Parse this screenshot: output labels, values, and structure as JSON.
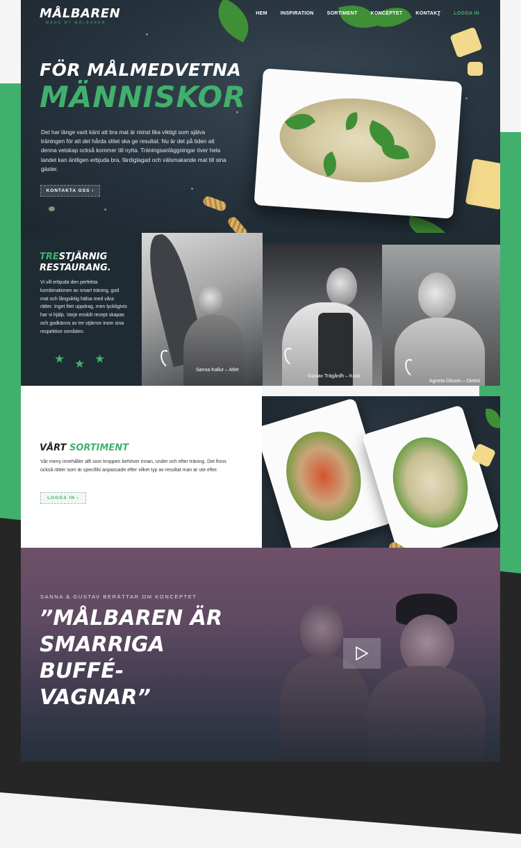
{
  "brand": {
    "name": "MÅLBAREN",
    "tagline": "MADE BY MÅLBAREN"
  },
  "nav": {
    "items": [
      "HEM",
      "INSPIRATION",
      "SORTIMENT",
      "KONCEPTET",
      "KONTAKT",
      "LOGGA IN"
    ]
  },
  "hero": {
    "title_line1": "FÖR MÅLMEDVETNA",
    "title_line2": "MÄNNISKOR",
    "body": "Det har länge varit känt att bra mat är minst lika viktigt som själva träningen för att det hårda slitet ska ge resultat. Nu är det på tiden att denna vetskap också kommer till nytta. Träningsanläggningar över hela landet kan äntligen erbjuda bra, färdiglagad och välsmakande mat till sina gäster.",
    "cta": "KONTAKTA OSS ›"
  },
  "restaurant": {
    "title_green": "TRE",
    "title_rest": "STJÄRNIG",
    "title_line2": "RESTAURANG.",
    "body": "Vi vill erbjuda den perfekta kombinationen av smart träning, god mat och långsiktig hälsa med våra rätter. Inget litet uppdrag, men lyckligtvis har vi hjälp. Varje enskilt recept skapas och godkänns av tre stjärnor inom sina respektive områden.",
    "stars": "★",
    "people": [
      {
        "caption": "Sanna Kallur – Atlet"
      },
      {
        "caption": "Gustav Trägårdh – Kock"
      },
      {
        "caption": "Agneta Olsson – Dietist"
      }
    ]
  },
  "sortiment": {
    "title_dark": "VÅRT ",
    "title_green": "SORTIMENT",
    "body": "Vår meny innehåller allt som kroppen behöver innan, under och efter träning. Det finns också rätter som är specifikt anpassade efter vilket typ av resultat man är ute efter.",
    "cta": "LOGGA IN ›"
  },
  "video": {
    "kicker": "SANNA & GUSTAV BERÄTTAR OM KONCEPTET",
    "quote": "”MÅLBAREN ÄR SMARRIGA BUFFÉ-VAGNAR”"
  },
  "colors": {
    "accent": "#41b06d",
    "dark": "#1f2b33",
    "purple": "#6e5068"
  },
  "icons": {
    "play": "play-icon",
    "star": "star-icon",
    "chevron": "chevron-right-icon"
  }
}
